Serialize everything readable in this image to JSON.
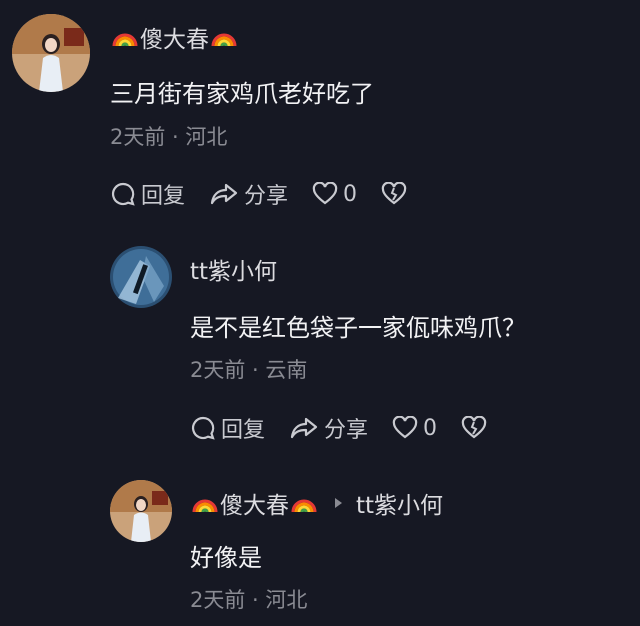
{
  "comments": [
    {
      "author": "傻大春",
      "text": "三月街有家鸡爪老好吃了",
      "meta": "2天前 · 河北",
      "actions": {
        "reply": "回复",
        "share": "分享",
        "likes": "0"
      }
    },
    {
      "author": "tt紫小何",
      "text": "是不是红色袋子一家佤味鸡爪？",
      "meta": "2天前 · 云南",
      "actions": {
        "reply": "回复",
        "share": "分享",
        "likes": "0"
      }
    },
    {
      "author": "傻大春",
      "reply_to": "tt紫小何",
      "text": "好像是",
      "meta": "2天前 · 河北"
    }
  ]
}
